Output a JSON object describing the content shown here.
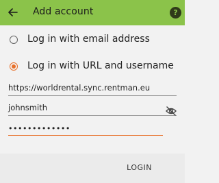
{
  "appbar": {
    "title": "Add account",
    "help_label": "?"
  },
  "options": [
    {
      "label": "Log in with email address",
      "selected": false
    },
    {
      "label": "Log in with URL and username",
      "selected": true
    }
  ],
  "fields": {
    "url": {
      "value": "https://worldrental.sync.rentman.eu"
    },
    "username": {
      "value": "johnsmith"
    },
    "password": {
      "value": "•••••••••••••"
    }
  },
  "actions": {
    "login_label": "LOGIN"
  },
  "colors": {
    "appbar": "#8bc34a",
    "accent": "#e8702a",
    "background": "#f2f2f2"
  },
  "icons": {
    "back": "arrow-left-icon",
    "help": "help-icon",
    "visibility": "visibility-off-icon"
  }
}
